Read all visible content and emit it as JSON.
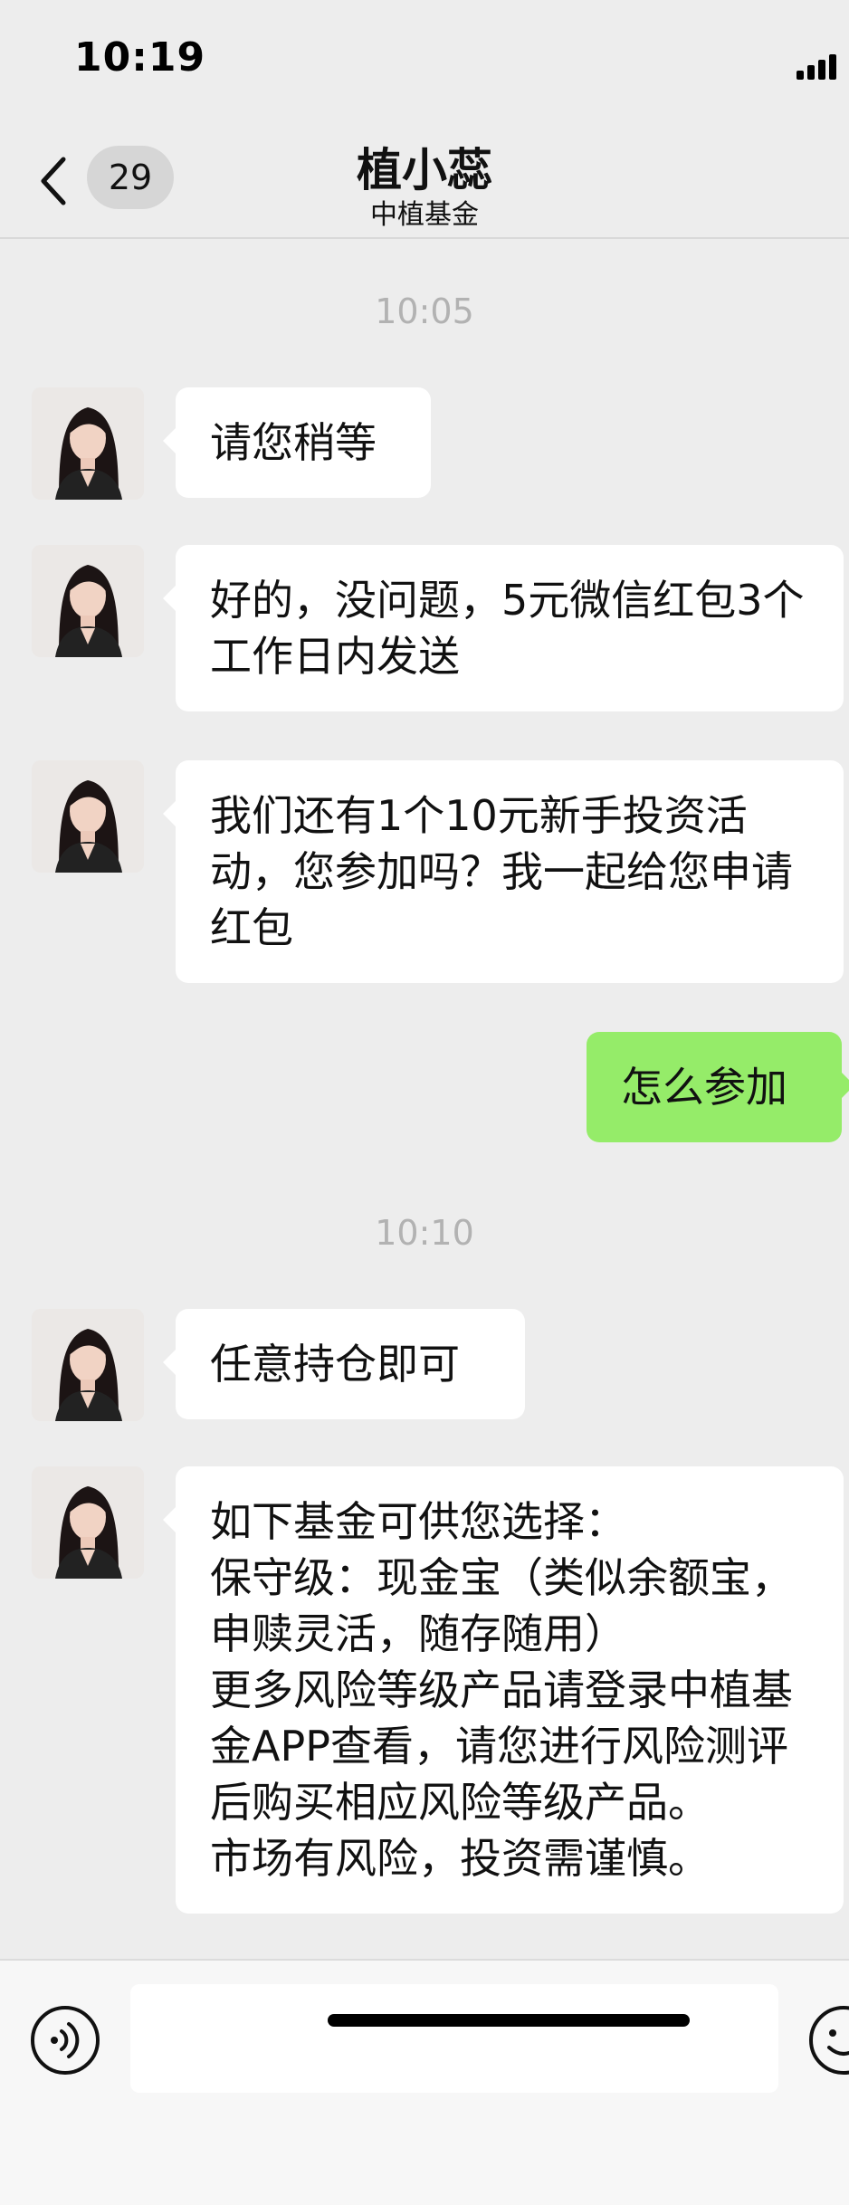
{
  "status_bar": {
    "time": "10:19"
  },
  "nav": {
    "unread_count": "29",
    "title": "植小蕊",
    "subtitle": "中植基金"
  },
  "messages": {
    "ts1": "10:05",
    "m1": "请您稍等",
    "m2": "好的，没问题，5元微信红包3个工作日内发送",
    "m3": "我们还有1个10元新手投资活动，您参加吗？我一起给您申请红包",
    "m4": "怎么参加",
    "ts2": "10:10",
    "m5": "任意持仓即可",
    "m6": "如下基金可供您选择：\n保守级：现金宝（类似余额宝，申赎灵活，随存随用）\n更多风险等级产品请登录中植基金APP查看，请您进行风险测评后购买相应风险等级产品。\n市场有风险，投资需谨慎。"
  },
  "colors": {
    "background": "#ededed",
    "incoming_bubble": "#ffffff",
    "outgoing_bubble": "#95ec69",
    "timestamp": "#b2b2b2"
  },
  "icons": {
    "back": "chevron-left-icon",
    "voice": "voice-icon",
    "emoji": "emoji-icon",
    "signal": "signal-icon"
  }
}
